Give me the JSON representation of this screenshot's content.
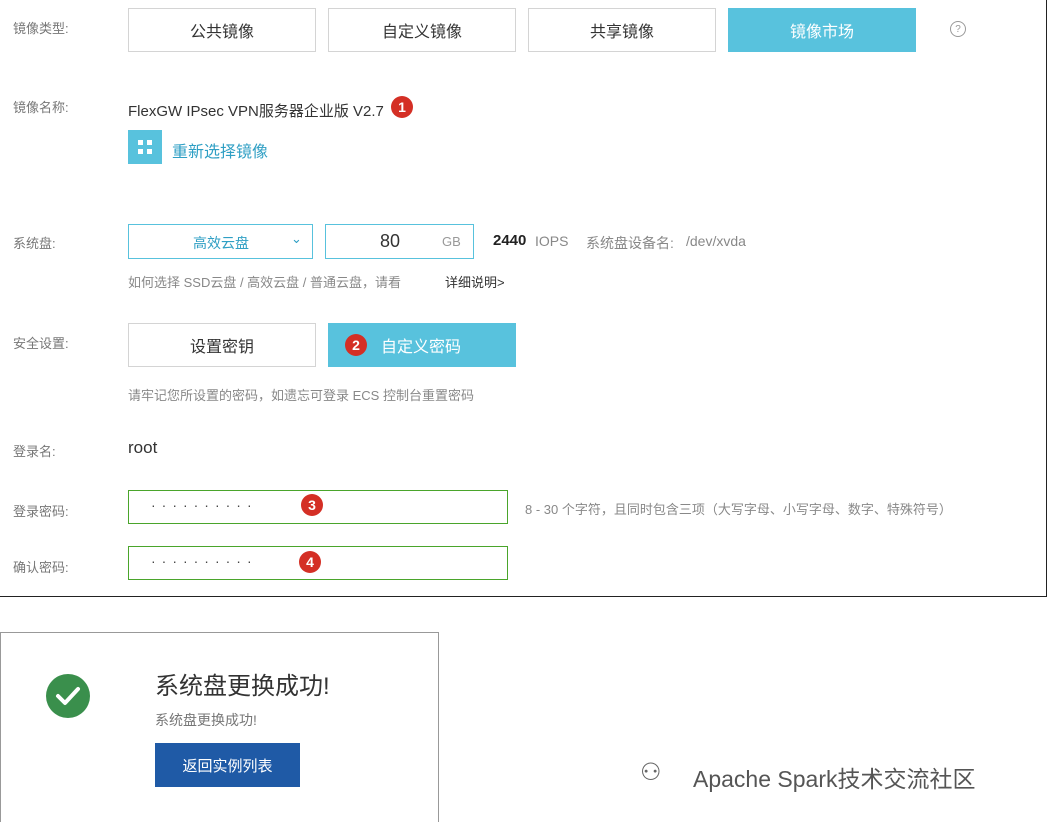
{
  "image_type": {
    "label": "镜像类型:",
    "tabs": [
      {
        "label": "公共镜像"
      },
      {
        "label": "自定义镜像"
      },
      {
        "label": "共享镜像"
      },
      {
        "label": "镜像市场"
      }
    ],
    "help": "?"
  },
  "image_name": {
    "label": "镜像名称:",
    "value": "FlexGW IPsec VPN服务器企业版 V2.7",
    "badge": "1",
    "reselect_link": "重新选择镜像"
  },
  "system_disk": {
    "label": "系统盘:",
    "type": "高效云盘",
    "size": "80",
    "unit": "GB",
    "iops_value": "2440",
    "iops_unit": "IOPS",
    "device_label": "系统盘设备名:",
    "device": "/dev/xvda",
    "help_text": "如何选择 SSD云盘 / 高效云盘 / 普通云盘，请看",
    "help_link": "详细说明>"
  },
  "security": {
    "label": "安全设置:",
    "options": [
      {
        "label": "设置密钥"
      },
      {
        "label": "自定义密码"
      }
    ],
    "badge": "2",
    "note": "请牢记您所设置的密码，如遗忘可登录 ECS 控制台重置密码"
  },
  "login_name": {
    "label": "登录名:",
    "value": "root"
  },
  "password": {
    "label": "登录密码:",
    "value": "··········",
    "badge": "3",
    "hint": "8 - 30 个字符，且同时包含三项（大写字母、小写字母、数字、特殊符号）"
  },
  "confirm": {
    "label": "确认密码:",
    "value": "··········",
    "badge": "4"
  },
  "success": {
    "title": "系统盘更换成功!",
    "subtitle": "系统盘更换成功!",
    "button": "返回实例列表"
  },
  "watermark": "Apache Spark技术交流社区",
  "colors": {
    "accent": "#58c2dd",
    "badge": "#d42f25",
    "success": "#3a8f4c",
    "primary_btn": "#1f5aa6",
    "valid_border": "#4aa52b"
  }
}
